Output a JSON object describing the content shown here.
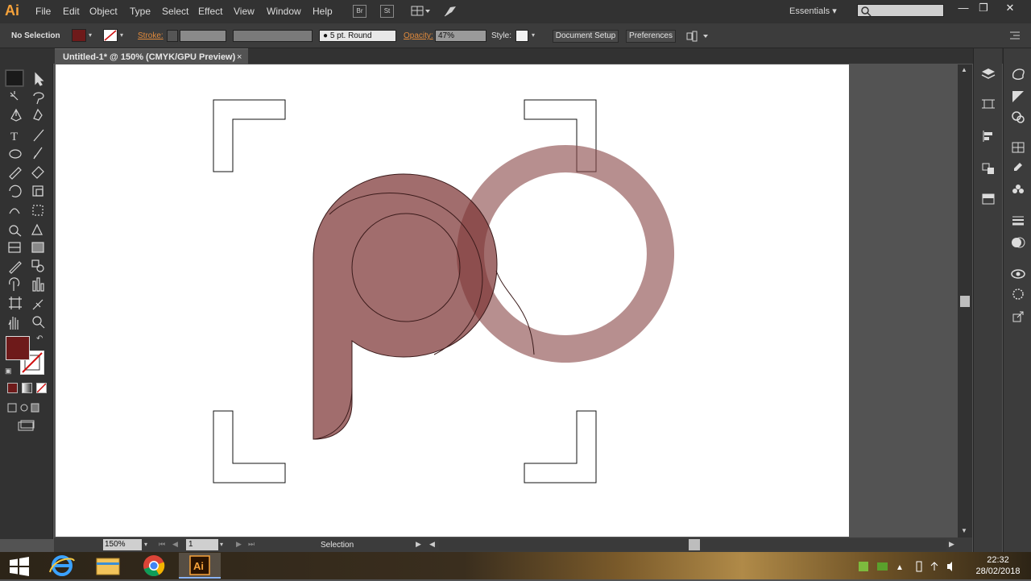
{
  "app": {
    "logo": "Ai",
    "workspace": "Essentials"
  },
  "menu": [
    "File",
    "Edit",
    "Object",
    "Type",
    "Select",
    "Effect",
    "View",
    "Window",
    "Help"
  ],
  "appbar_buttons": {
    "bridge": "Br",
    "stock": "St"
  },
  "control_bar": {
    "selection": "No Selection",
    "stroke_label": "Stroke:",
    "brush": "5 pt. Round",
    "opacity_label": "Opacity:",
    "opacity_value": "47%",
    "style_label": "Style:",
    "document_setup": "Document Setup",
    "preferences": "Preferences"
  },
  "document_tab": {
    "title": "Untitled-1* @ 150% (CMYK/GPU Preview)",
    "close": "×"
  },
  "status_bar": {
    "zoom": "150%",
    "page": "1",
    "tool": "Selection"
  },
  "colors": {
    "fill": "#6e1a1a",
    "artwork": "#8b4a4a",
    "overlap": "#7a3a3d"
  },
  "icons": {
    "tools": [
      "selection-icon",
      "direct-selection-icon",
      "magic-wand-icon",
      "lasso-icon",
      "pen-icon",
      "curvature-icon",
      "type-icon",
      "line-icon",
      "ellipse-icon",
      "paintbrush-icon",
      "pencil-icon",
      "eraser-icon",
      "rotate-icon",
      "scale-icon",
      "warp-icon",
      "free-transform-icon",
      "shape-builder-icon",
      "perspective-icon",
      "mesh-icon",
      "gradient-icon",
      "eyedropper-icon",
      "blend-icon",
      "symbol-sprayer-icon",
      "column-graph-icon",
      "artboard-icon",
      "slice-icon",
      "hand-icon",
      "zoom-icon"
    ]
  },
  "taskbar": {
    "time": "22:32",
    "date": "28/02/2018"
  }
}
